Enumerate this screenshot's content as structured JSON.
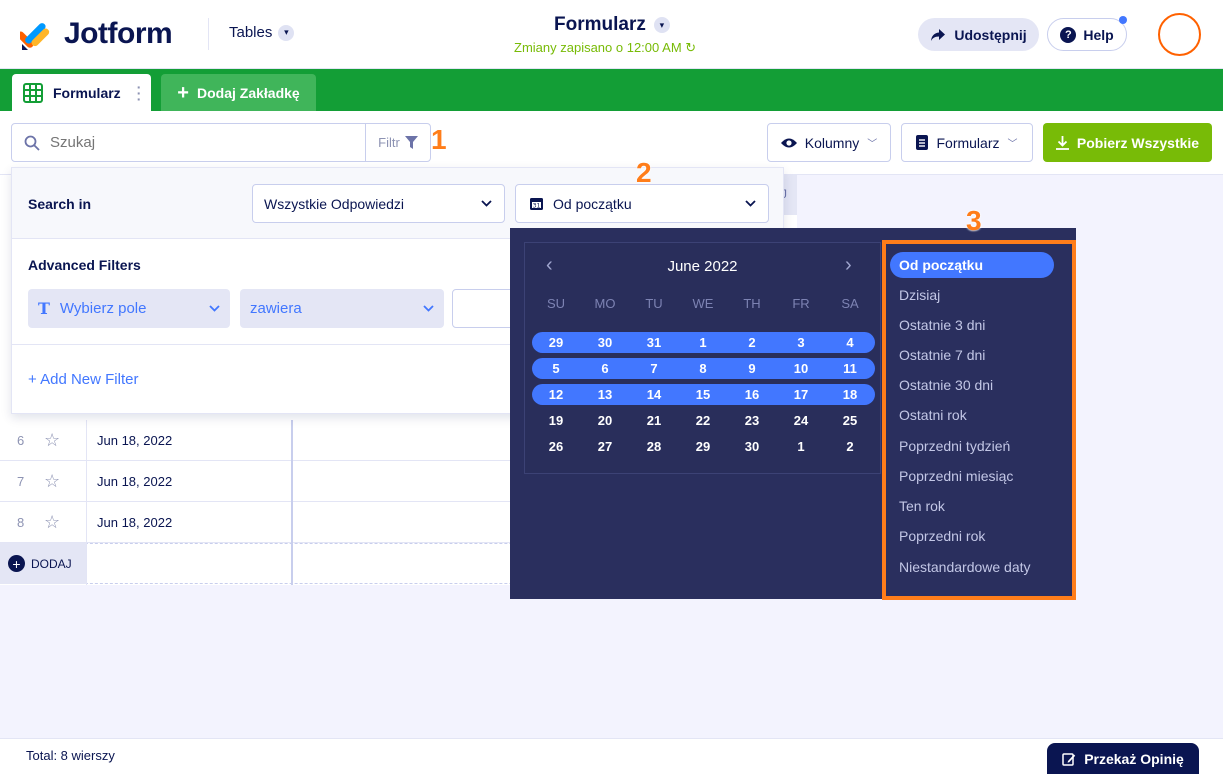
{
  "header": {
    "logo_text": "Jotform",
    "tables_label": "Tables",
    "form_title": "Formularz",
    "saved_status": "Zmiany zapisano o 12:00 AM",
    "share_label": "Udostępnij",
    "help_label": "Help"
  },
  "tabs": {
    "active_label": "Formularz",
    "add_label": "Dodaj Zakładkę"
  },
  "toolbar": {
    "search_placeholder": "Szukaj",
    "filter_label": "Filtr",
    "columns_label": "Kolumny",
    "form_label": "Formularz",
    "download_label": "Pobierz Wszystkie"
  },
  "annotations": [
    "1",
    "2",
    "3"
  ],
  "filter_panel": {
    "search_in_label": "Search in",
    "responses_select": "Wszystkie Odpowiedzi",
    "date_select": "Od początku",
    "advanced_label": "Advanced Filters",
    "field_select": "Wybierz pole",
    "condition_select": "zawiera",
    "add_filter_label": "+ Add New Filter"
  },
  "table": {
    "header_partial": "J",
    "rows": [
      {
        "num": "6",
        "date": "Jun 18, 2022"
      },
      {
        "num": "7",
        "date": "Jun 18, 2022"
      },
      {
        "num": "8",
        "date": "Jun 18, 2022"
      }
    ],
    "add_row_label": "DODAJ"
  },
  "calendar": {
    "month_label": "June 2022",
    "weekdays": [
      "SU",
      "MO",
      "TU",
      "WE",
      "TH",
      "FR",
      "SA"
    ],
    "weeks": [
      [
        "29",
        "30",
        "31",
        "1",
        "2",
        "3",
        "4"
      ],
      [
        "5",
        "6",
        "7",
        "8",
        "9",
        "10",
        "11"
      ],
      [
        "12",
        "13",
        "14",
        "15",
        "16",
        "17",
        "18"
      ],
      [
        "19",
        "20",
        "21",
        "22",
        "23",
        "24",
        "25"
      ],
      [
        "26",
        "27",
        "28",
        "29",
        "30",
        "1",
        "2"
      ]
    ],
    "selected_weeks": 3
  },
  "presets": {
    "items": [
      "Od początku",
      "Dzisiaj",
      "Ostatnie 3 dni",
      "Ostatnie 7 dni",
      "Ostatnie 30 dni",
      "Ostatni rok",
      "Poprzedni tydzień",
      "Poprzedni miesiąc",
      "Ten rok",
      "Poprzedni rok",
      "Niestandardowe daty"
    ],
    "active_index": 0
  },
  "footer": {
    "total_label": "Total: 8 wierszy",
    "feedback_label": "Przekaż Opinię"
  },
  "colors": {
    "brand_navy": "#0a1551",
    "tab_green": "#139e36",
    "download_green": "#78bb07",
    "accent_blue": "#4277ff",
    "annotation_orange": "#ff7d1a"
  }
}
